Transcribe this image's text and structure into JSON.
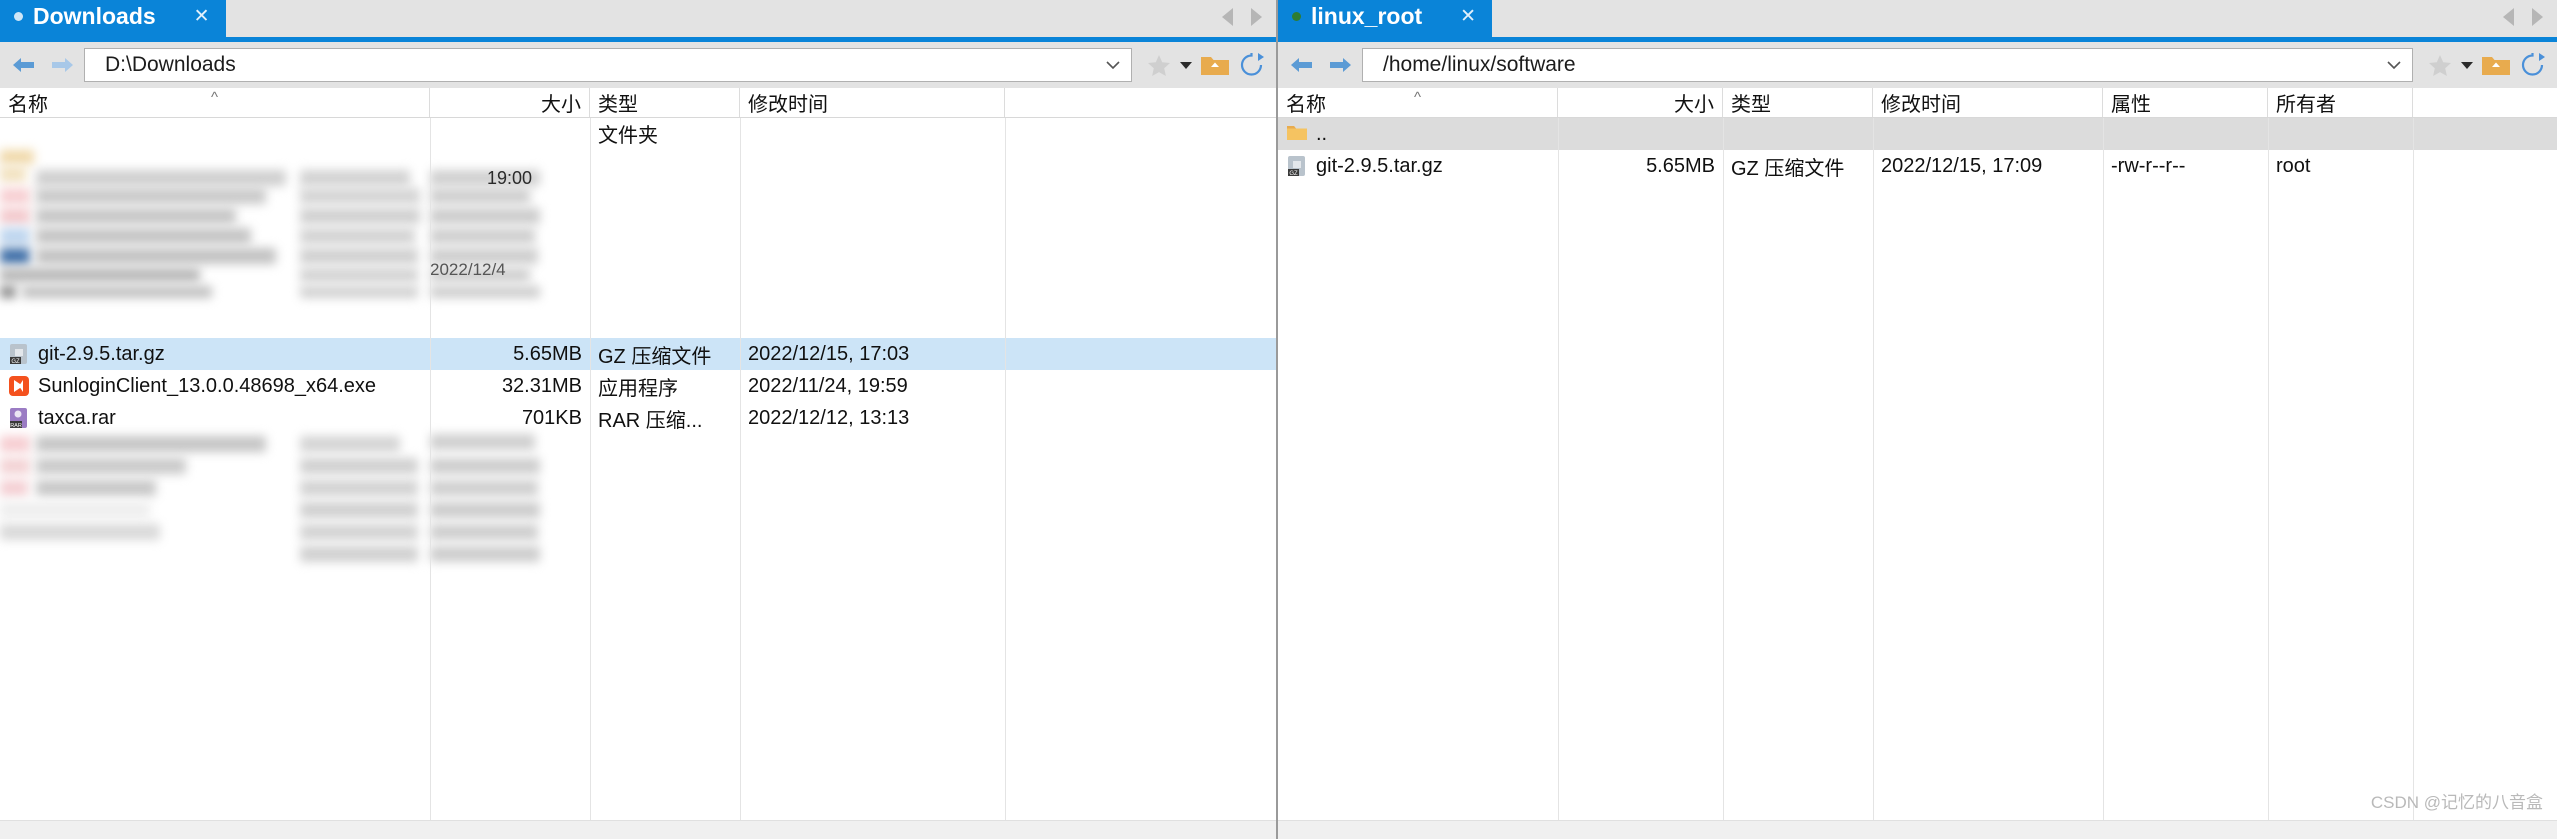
{
  "left_pane": {
    "tab": {
      "label": "Downloads",
      "close_icon": "close-icon",
      "status_dot": "status-dot"
    },
    "tab_nav": {
      "prev_icon": "chevron-left-icon",
      "next_icon": "chevron-right-icon"
    },
    "address": {
      "back_icon": "arrow-back-icon",
      "forward_icon": "arrow-forward-icon",
      "path": "D:\\Downloads",
      "dropdown_icon": "chevron-down-icon",
      "star_icon": "star-icon",
      "star_caret_icon": "caret-down-icon",
      "parent_folder_icon": "folder-up-icon",
      "refresh_icon": "refresh-icon"
    },
    "columns": [
      {
        "key": "name",
        "label": "名称",
        "sorted": true,
        "sort_icon": "sort-asc-icon"
      },
      {
        "key": "size",
        "label": "大小"
      },
      {
        "key": "type",
        "label": "类型"
      },
      {
        "key": "date",
        "label": "修改时间"
      }
    ],
    "subheader_type": "文件夹",
    "rows": [
      {
        "name": "git-2.9.5.tar.gz",
        "size": "5.65MB",
        "type": "GZ 压缩文件",
        "date": "2022/12/15, 17:03",
        "icon": "gz-archive-icon",
        "selected": true
      },
      {
        "name": "SunloginClient_13.0.0.48698_x64.exe",
        "size": "32.31MB",
        "type": "应用程序",
        "date": "2022/11/24, 19:59",
        "icon": "exe-application-icon",
        "selected": false
      },
      {
        "name": "taxca.rar",
        "size": "701KB",
        "type": "RAR 压缩...",
        "date": "2022/12/12, 13:13",
        "icon": "rar-archive-icon",
        "selected": false
      }
    ],
    "redacted_dates": [
      "19:00",
      "2022/12/4"
    ]
  },
  "right_pane": {
    "tab": {
      "label": "linux_root",
      "close_icon": "close-icon",
      "status_dot": "status-dot"
    },
    "tab_nav": {
      "prev_icon": "chevron-left-icon",
      "next_icon": "chevron-right-icon"
    },
    "address": {
      "back_icon": "arrow-back-icon",
      "forward_icon": "arrow-forward-icon",
      "path": "/home/linux/software",
      "dropdown_icon": "chevron-down-icon",
      "star_icon": "star-icon",
      "star_caret_icon": "caret-down-icon",
      "parent_folder_icon": "folder-up-icon",
      "refresh_icon": "refresh-icon"
    },
    "columns": [
      {
        "key": "name",
        "label": "名称",
        "sorted": true,
        "sort_icon": "sort-asc-icon"
      },
      {
        "key": "size",
        "label": "大小"
      },
      {
        "key": "type",
        "label": "类型"
      },
      {
        "key": "date",
        "label": "修改时间"
      },
      {
        "key": "attr",
        "label": "属性"
      },
      {
        "key": "owner",
        "label": "所有者"
      }
    ],
    "rows": [
      {
        "name": "..",
        "size": "",
        "type": "",
        "date": "",
        "attr": "",
        "owner": "",
        "icon": "folder-icon",
        "parent": true
      },
      {
        "name": "git-2.9.5.tar.gz",
        "size": "5.65MB",
        "type": "GZ 压缩文件",
        "date": "2022/12/15, 17:09",
        "attr": "-rw-r--r--",
        "owner": "root",
        "icon": "gz-archive-icon",
        "parent": false
      }
    ]
  },
  "watermark": "CSDN @记忆的八音盒"
}
